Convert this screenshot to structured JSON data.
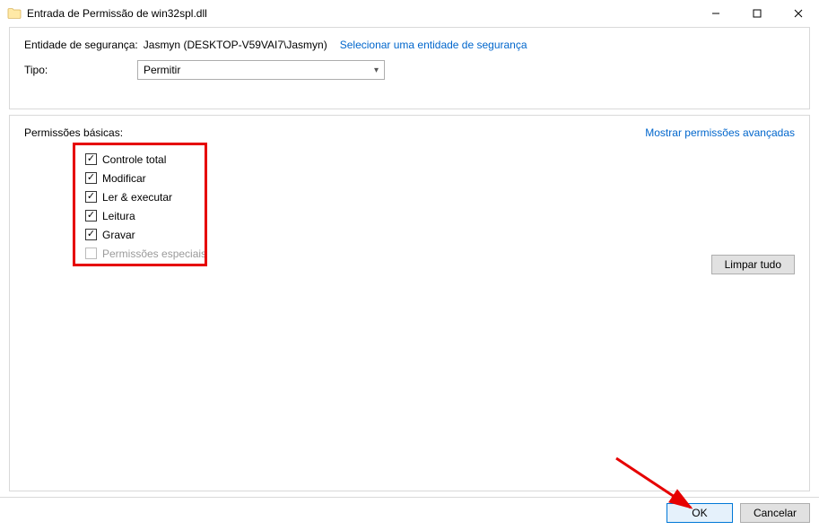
{
  "titlebar": {
    "title": "Entrada de Permissão de win32spl.dll"
  },
  "top_panel": {
    "principal_label": "Entidade de segurança:",
    "principal_value": "Jasmyn (DESKTOP-V59VAI7\\Jasmyn)",
    "select_link": "Selecionar uma entidade de segurança",
    "type_label": "Tipo:",
    "type_value": "Permitir"
  },
  "perm_panel": {
    "title": "Permissões básicas:",
    "advanced_link": "Mostrar permissões avançadas",
    "items": [
      {
        "label": "Controle total",
        "checked": true,
        "enabled": true
      },
      {
        "label": "Modificar",
        "checked": true,
        "enabled": true
      },
      {
        "label": "Ler & executar",
        "checked": true,
        "enabled": true
      },
      {
        "label": "Leitura",
        "checked": true,
        "enabled": true
      },
      {
        "label": "Gravar",
        "checked": true,
        "enabled": true
      },
      {
        "label": "Permissões especiais",
        "checked": false,
        "enabled": false
      }
    ],
    "clear_all": "Limpar tudo"
  },
  "footer": {
    "ok": "OK",
    "cancel": "Cancelar"
  }
}
